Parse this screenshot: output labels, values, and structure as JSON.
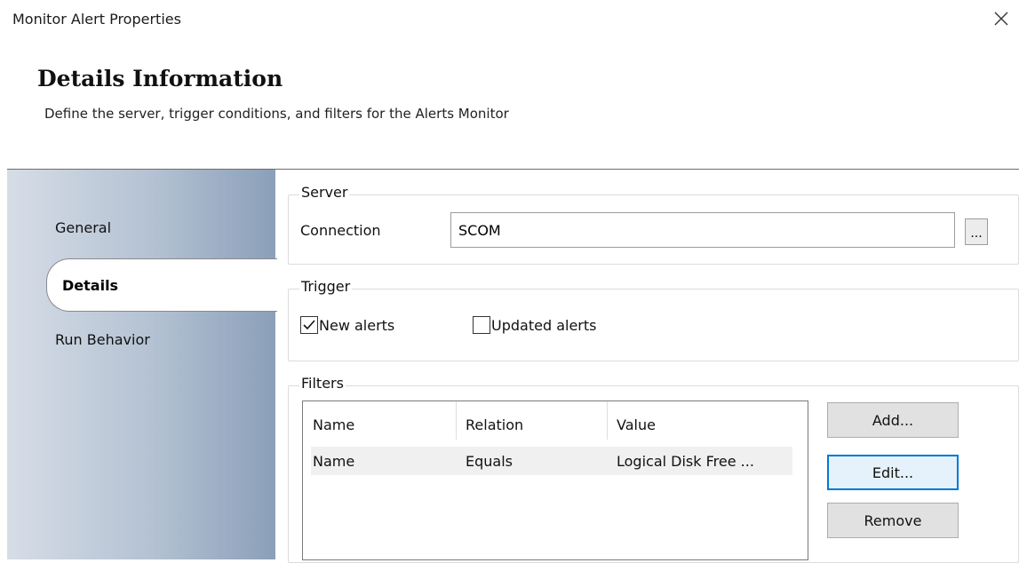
{
  "window": {
    "title": "Monitor Alert Properties"
  },
  "header": {
    "title": "Details Information",
    "subtitle": "Define the server, trigger conditions, and filters for the Alerts Monitor"
  },
  "nav": {
    "items": [
      {
        "label": "General"
      },
      {
        "label": "Details",
        "selected": true
      },
      {
        "label": "Run Behavior"
      }
    ]
  },
  "server": {
    "group_label": "Server",
    "connection_label": "Connection",
    "connection_value": "SCOM",
    "browse_label": "..."
  },
  "trigger": {
    "group_label": "Trigger",
    "new_alerts_label": "New alerts",
    "new_alerts_checked": true,
    "updated_alerts_label": "Updated alerts",
    "updated_alerts_checked": false
  },
  "filters": {
    "group_label": "Filters",
    "columns": [
      "Name",
      "Relation",
      "Value"
    ],
    "rows": [
      {
        "name": "Name",
        "relation": "Equals",
        "value": "Logical Disk Free ..."
      }
    ],
    "add_label": "Add...",
    "edit_label": "Edit...",
    "remove_label": "Remove"
  },
  "colors": {
    "focus_border": "#0078d7",
    "nav_gradient_light": "#d6dde7",
    "nav_gradient_dark": "#8b9fb9"
  }
}
